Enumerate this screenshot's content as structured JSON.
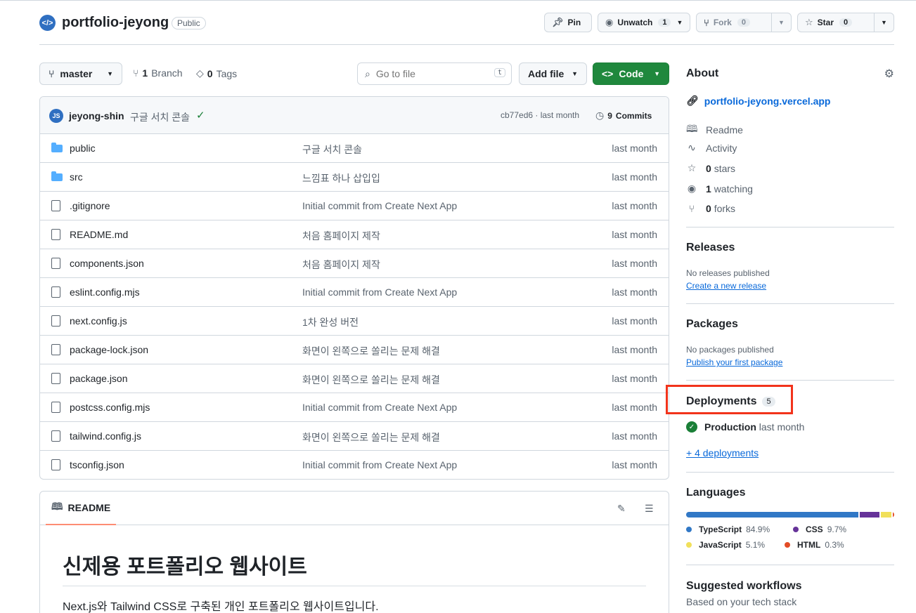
{
  "repo": {
    "name": "portfolio-jeyong",
    "visibility": "Public",
    "logo_glyph": "</>",
    "pin_label": "Pin",
    "unwatch_label": "Unwatch",
    "watch_count": "1",
    "fork_label": "Fork",
    "fork_count": "0",
    "star_label": "Star",
    "star_count": "0"
  },
  "toolbar": {
    "branch": "master",
    "branch_count": "1",
    "branch_label": "Branch",
    "tag_count": "0",
    "tag_label": "Tags",
    "search_placeholder": "Go to file",
    "search_kbd": "t",
    "add_file_label": "Add file",
    "code_label": "Code"
  },
  "commit": {
    "author": "jeyong-shin",
    "message": "구글 서치 콘솔",
    "hash_time": "cb77ed6 · last month",
    "commits_count": "9",
    "commits_label": "Commits"
  },
  "files": [
    {
      "name": "public",
      "type": "folder",
      "message": "구글 서치 콘솔",
      "date": "last month"
    },
    {
      "name": "src",
      "type": "folder",
      "message": "느낌표 하나 삽입입",
      "date": "last month"
    },
    {
      "name": ".gitignore",
      "type": "file",
      "message": "Initial commit from Create Next App",
      "date": "last month"
    },
    {
      "name": "README.md",
      "type": "file",
      "message": "처음 홈페이지 제작",
      "date": "last month"
    },
    {
      "name": "components.json",
      "type": "file",
      "message": "처음 홈페이지 제작",
      "date": "last month"
    },
    {
      "name": "eslint.config.mjs",
      "type": "file",
      "message": "Initial commit from Create Next App",
      "date": "last month"
    },
    {
      "name": "next.config.js",
      "type": "file",
      "message": "1차 완성 버전",
      "date": "last month"
    },
    {
      "name": "package-lock.json",
      "type": "file",
      "message": "화면이 왼쪽으로 쏠리는 문제 해결",
      "date": "last month"
    },
    {
      "name": "package.json",
      "type": "file",
      "message": "화면이 왼쪽으로 쏠리는 문제 해결",
      "date": "last month"
    },
    {
      "name": "postcss.config.mjs",
      "type": "file",
      "message": "Initial commit from Create Next App",
      "date": "last month"
    },
    {
      "name": "tailwind.config.js",
      "type": "file",
      "message": "화면이 왼쪽으로 쏠리는 문제 해결",
      "date": "last month"
    },
    {
      "name": "tsconfig.json",
      "type": "file",
      "message": "Initial commit from Create Next App",
      "date": "last month"
    }
  ],
  "readme": {
    "tab_label": "README",
    "title": "신제용 포트폴리오 웹사이트",
    "text": "Next.js와 Tailwind CSS로 구축된 개인 포트폴리오 웹사이트입니다."
  },
  "about": {
    "title": "About",
    "website": "portfolio-jeyong.vercel.app",
    "readme": "Readme",
    "activity": "Activity",
    "stars_count": "0",
    "stars_label": "stars",
    "watching_count": "1",
    "watching_label": "watching",
    "forks_count": "0",
    "forks_label": "forks"
  },
  "releases": {
    "title": "Releases",
    "none": "No releases published",
    "create": "Create a new release"
  },
  "packages": {
    "title": "Packages",
    "none": "No packages published",
    "publish": "Publish your first package"
  },
  "deployments": {
    "title": "Deployments",
    "count": "5",
    "env": "Production",
    "time": "last month",
    "more": "+ 4 deployments"
  },
  "languages": {
    "title": "Languages",
    "items": [
      {
        "name": "TypeScript",
        "percent": "84.9%",
        "color": "#3178c6",
        "value": 84.9
      },
      {
        "name": "CSS",
        "percent": "9.7%",
        "color": "#663399",
        "value": 9.7
      },
      {
        "name": "JavaScript",
        "percent": "5.1%",
        "color": "#f1e05a",
        "value": 5.1
      },
      {
        "name": "HTML",
        "percent": "0.3%",
        "color": "#e34c26",
        "value": 0.3
      }
    ]
  },
  "workflows": {
    "title": "Suggested workflows",
    "subtitle": "Based on your tech stack"
  }
}
